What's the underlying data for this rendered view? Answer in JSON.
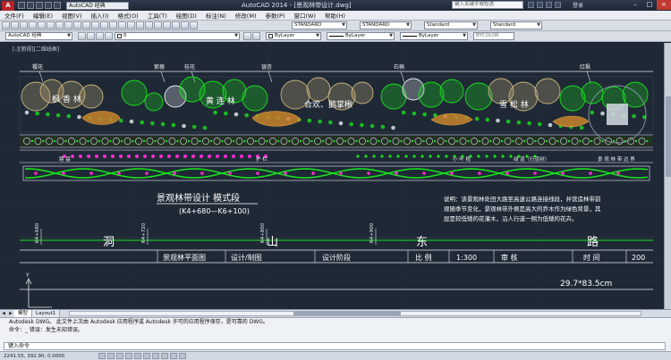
{
  "app": {
    "logo": "A",
    "workspace": "AutoCAD 经典",
    "title": "AutoCAD 2014 - [景观林带设计.dwg]",
    "search_placeholder": "键入关键字或短语",
    "login": "登录"
  },
  "menu": [
    "文件(F)",
    "编辑(E)",
    "视图(V)",
    "插入(I)",
    "格式(O)",
    "工具(T)",
    "绘图(D)",
    "标注(N)",
    "修改(M)",
    "参数(P)",
    "窗口(W)",
    "帮助(H)"
  ],
  "toolbar1": {
    "text_style": "STANDARD",
    "dim_style": "STANDARD",
    "table_style": "Standard",
    "mleader_style": "Standard"
  },
  "toolbar2": {
    "workspace": "AutoCAD 经典",
    "layer": "0",
    "color": "ByLayer",
    "linetype": "ByLayer",
    "lineweight": "ByLayer",
    "plotstyle": "BYCOLOR"
  },
  "viewport_label": "[-][俯视][二维线框]",
  "drawing": {
    "top_labels": [
      "樱花",
      "紫薇",
      "桂花",
      "银杏",
      "石楠",
      "红枫"
    ],
    "zone_names": [
      "枫 香 林",
      "黄 连 林",
      "合欢、鹅掌楸",
      "雪    松    林"
    ],
    "sidewalk_labels": [
      "路 基",
      "护 栏",
      "小 叶 榄",
      "绿 道（行道树）",
      "景 观 林 带 边 界"
    ],
    "title": "景观林带设计 模式段",
    "subtitle": "(K4+680—K6+100)",
    "note_lines": [
      "说明：该景观林处田大路至高速公路连接线段，并营造林带前",
      "观随季节变化，景观林带外侧是高大的乔木作为绿色背景，其",
      "层是较低矮的花灌木，沿人行道一侧为低矮的花卉。"
    ],
    "road_chars": [
      "洞",
      "山",
      "东",
      "路"
    ],
    "stations": [
      "K4+680",
      "K4+720",
      "K4+800",
      "K4+900"
    ],
    "titleblock": {
      "drawing_name": "景观林平面图",
      "designer": "设计/制图",
      "stage": "设计阶段",
      "scale_label": "比 例",
      "scale": "1:300",
      "reviewer": "审 核",
      "time_label": "时 间",
      "year": "200",
      "sheet_size": "29.7*83.5cm"
    },
    "colors": {
      "green": "#19e01c",
      "pink": "#ff2ad4",
      "orange": "#c8832a",
      "tan": "#c9b37a",
      "white": "#e8ecf0",
      "grid": "#2a3443"
    }
  },
  "tabs": [
    "模型",
    "Layout1"
  ],
  "command": {
    "history_1": "Autodesk DWG。 此文件上次由 Autodesk 应用程序或 Autodesk 许可的应用程序保存，是可靠的 DWG。",
    "history_2": "命令：_ 错误：发生未知错误。",
    "prompt": "键入命令"
  },
  "status": {
    "coords": "2241.55, 392.90, 0.0000"
  }
}
